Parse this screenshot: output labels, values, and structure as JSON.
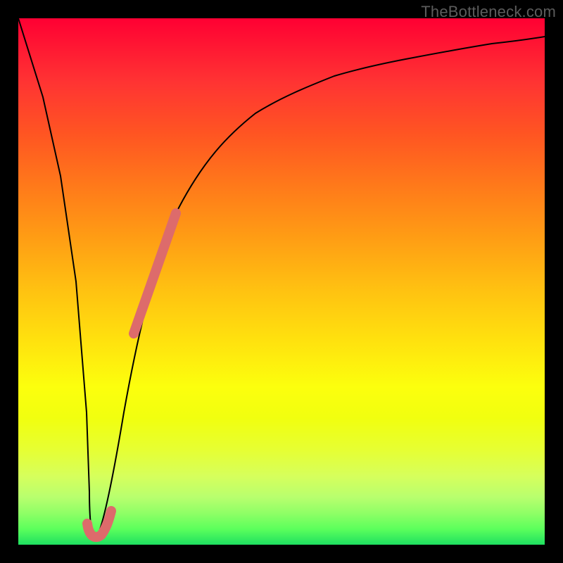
{
  "watermark": "TheBottleneck.com",
  "colors": {
    "frame": "#000000",
    "curve": "#000000",
    "marker": "#dd6b6b"
  },
  "chart_data": {
    "type": "line",
    "title": "",
    "xlabel": "",
    "ylabel": "",
    "xlim": [
      0,
      100
    ],
    "ylim": [
      0,
      100
    ],
    "grid": false,
    "legend_position": "none",
    "series": [
      {
        "name": "bottleneck-curve",
        "x": [
          0,
          2,
          4,
          6,
          8,
          10,
          12,
          13.5,
          15,
          18,
          22,
          26,
          30,
          35,
          40,
          45,
          50,
          55,
          60,
          65,
          70,
          75,
          80,
          85,
          90,
          95,
          100
        ],
        "y": [
          100,
          85,
          70,
          55,
          40,
          25,
          10,
          1,
          6,
          22,
          40,
          54,
          63,
          72,
          78,
          82,
          85,
          88,
          90,
          91.5,
          92.8,
          93.8,
          94.5,
          95.2,
          95.7,
          96.1,
          96.5
        ]
      }
    ],
    "highlights": [
      {
        "name": "marker-band",
        "on_series": "bottleneck-curve",
        "x_start": 22,
        "x_end": 30,
        "note": "salmon thick overlay on ascending branch"
      },
      {
        "name": "marker-hook",
        "on_series": "bottleneck-curve",
        "x_start": 12,
        "x_end": 15,
        "note": "small salmon J-hook at valley bottom"
      }
    ],
    "background_gradient": {
      "direction": "vertical",
      "stops": [
        {
          "pos": 0.0,
          "color": "#ff0033"
        },
        {
          "pos": 0.4,
          "color": "#ff9e14"
        },
        {
          "pos": 0.7,
          "color": "#fcff0d"
        },
        {
          "pos": 0.9,
          "color": "#b8ff6e"
        },
        {
          "pos": 1.0,
          "color": "#1ee060"
        }
      ]
    }
  }
}
